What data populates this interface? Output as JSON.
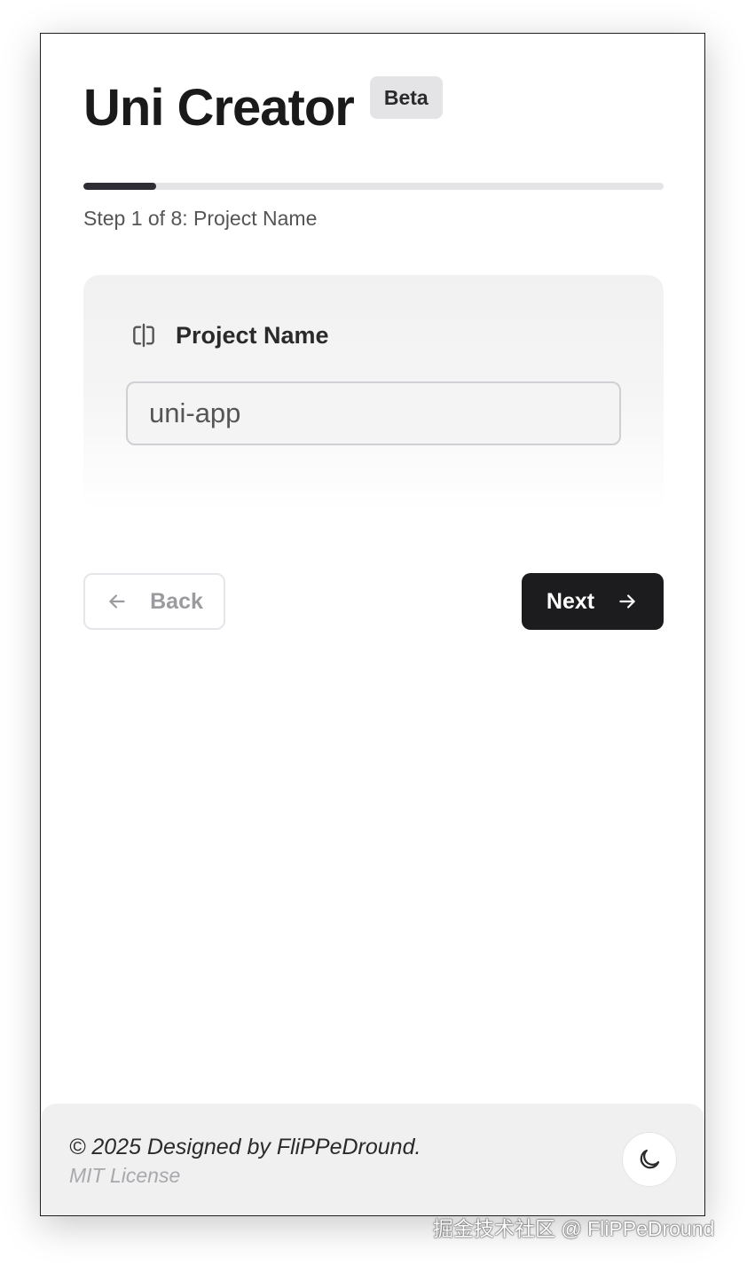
{
  "app": {
    "title": "Uni Creator",
    "badge": "Beta"
  },
  "progress": {
    "current_step": 1,
    "total_steps": 8,
    "fraction": 0.125,
    "label": "Step 1 of 8: Project Name"
  },
  "form": {
    "field_label": "Project Name",
    "field_icon": "text-cursor-input-icon",
    "field_value": "uni-app"
  },
  "nav": {
    "back_label": "Back",
    "back_icon": "arrow-left-icon",
    "next_label": "Next",
    "next_icon": "arrow-right-icon"
  },
  "footer": {
    "copyright": "© 2025 Designed by FliPPeDround.",
    "license": "MIT License",
    "theme_icon": "moon-icon"
  },
  "watermark": "掘金技术社区 @ FliPPeDround",
  "colors": {
    "accent": "#1c1c1e",
    "progress_track": "#e4e4e7",
    "badge_bg": "#e4e4e7",
    "footer_bg": "#f0f0f0"
  }
}
